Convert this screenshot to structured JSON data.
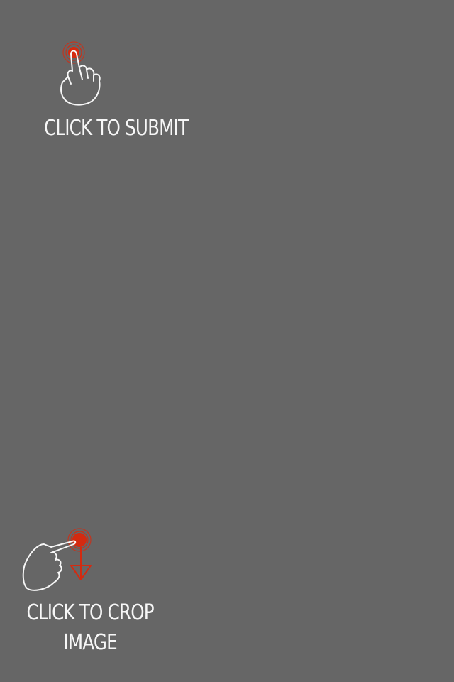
{
  "colors": {
    "background": "#666666",
    "accent": "#d42a10",
    "text": "#f7f7f7"
  },
  "hints": {
    "submit": {
      "icon": "tap-hand-icon",
      "label": "CLICK TO SUBMIT"
    },
    "crop": {
      "icon": "drag-down-hand-icon",
      "label_line1": "CLICK TO CROP",
      "label_line2": "IMAGE"
    }
  }
}
